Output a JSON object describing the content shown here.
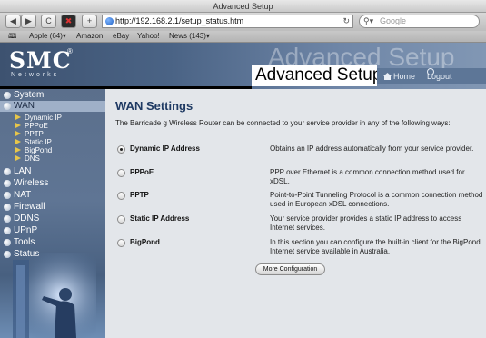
{
  "window": {
    "title": "Advanced Setup"
  },
  "toolbar": {
    "back": "◀",
    "forward": "▶",
    "reload": "C",
    "add": "+",
    "url": "http://192.168.2.1/setup_status.htm",
    "reload_glyph": "↻",
    "search_placeholder": "Google"
  },
  "bookmarks": [
    {
      "label": "Apple (64)▾"
    },
    {
      "label": "Amazon"
    },
    {
      "label": "eBay"
    },
    {
      "label": "Yahoo!"
    },
    {
      "label": "News (143)▾"
    }
  ],
  "header": {
    "logo": "SMC",
    "logo_mark": "®",
    "logo_sub": "Networks",
    "watermark": "Advanced Setup",
    "title": "Advanced Setup",
    "home": "Home",
    "logout": "Logout"
  },
  "sidebar": {
    "items": [
      {
        "label": "System"
      },
      {
        "label": "WAN"
      },
      {
        "label": "LAN"
      },
      {
        "label": "Wireless"
      },
      {
        "label": "NAT"
      },
      {
        "label": "Firewall"
      },
      {
        "label": "DDNS"
      },
      {
        "label": "UPnP"
      },
      {
        "label": "Tools"
      },
      {
        "label": "Status"
      }
    ],
    "wan_sub": [
      {
        "label": "Dynamic IP"
      },
      {
        "label": "PPPoE"
      },
      {
        "label": "PPTP"
      },
      {
        "label": "Static IP"
      },
      {
        "label": "BigPond"
      },
      {
        "label": "DNS"
      }
    ]
  },
  "main": {
    "heading": "WAN Settings",
    "intro": "The Barricade g Wireless Router can be connected to your service provider in any of the following ways:",
    "options": [
      {
        "label": "Dynamic IP Address",
        "desc": "Obtains an IP address automatically from your service provider.",
        "selected": true
      },
      {
        "label": "PPPoE",
        "desc": "PPP over Ethernet is a common connection method used for xDSL.",
        "selected": false
      },
      {
        "label": "PPTP",
        "desc": "Point-to-Point Tunneling Protocol is a common connection method used in European xDSL connections.",
        "selected": false
      },
      {
        "label": "Static IP Address",
        "desc": "Your service provider provides a static IP address to access Internet services.",
        "selected": false
      },
      {
        "label": "BigPond",
        "desc": "In this section you can configure the built-in client for the BigPond Internet service available in Australia.",
        "selected": false
      }
    ],
    "more_button": "More Configuration"
  },
  "colors": {
    "heading": "#1f3a63",
    "sidebar_active": "#9fb0c8",
    "content_bg": "#e3e6ea"
  }
}
